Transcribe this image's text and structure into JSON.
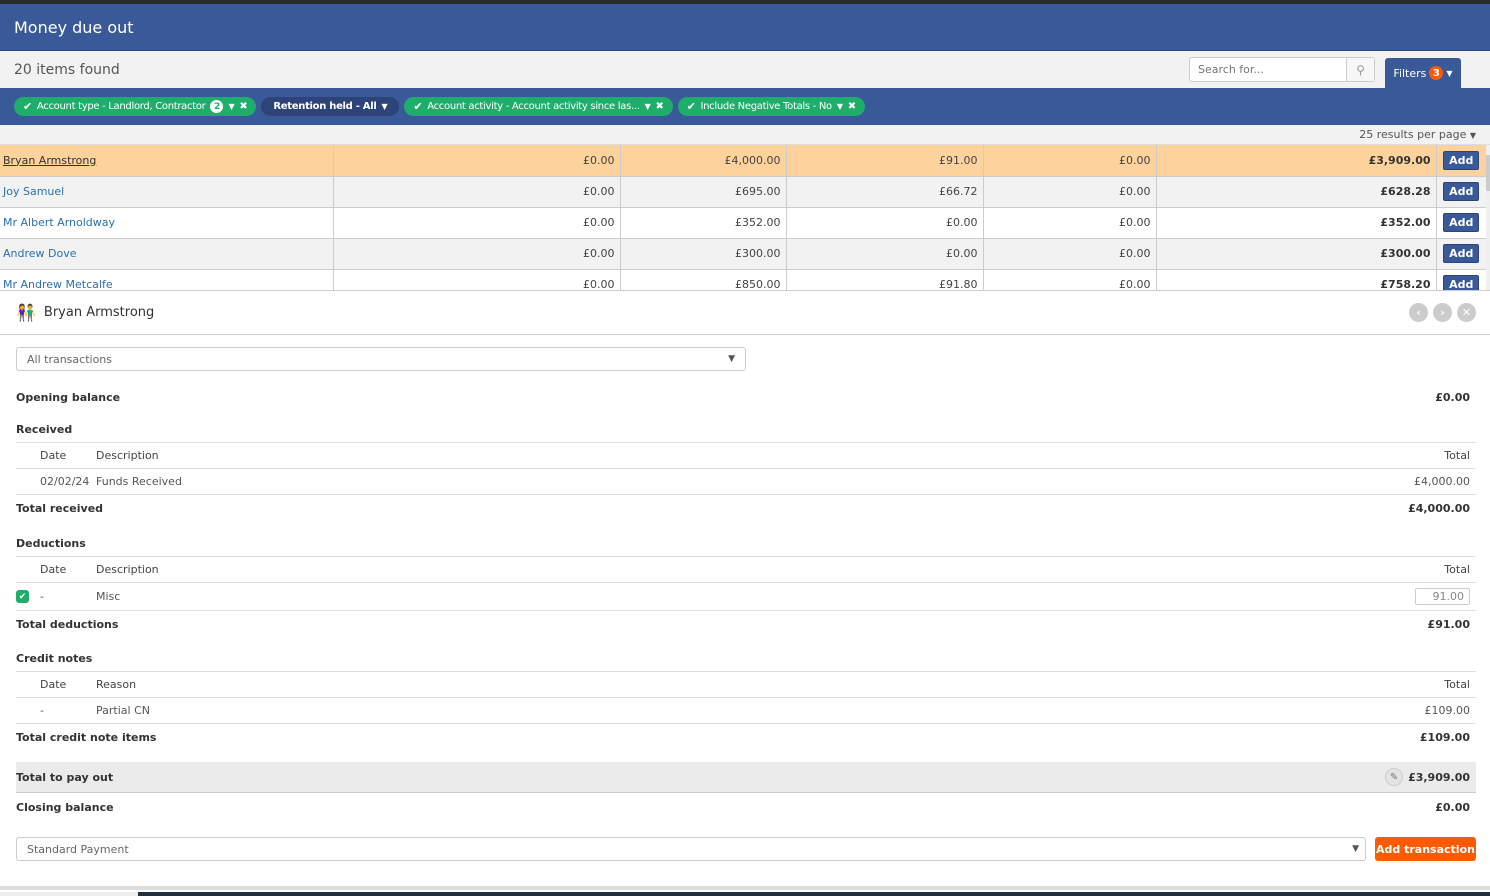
{
  "header": {
    "title": "Money due out"
  },
  "toolbar": {
    "items_found": "20 items found",
    "search_placeholder": "Search for...",
    "filters_label": "Filters",
    "filters_count": "3"
  },
  "filter_chips": [
    {
      "label": "Account type - Landlord, Contractor",
      "count": "2",
      "active": true,
      "removable": true
    },
    {
      "label": "Retention held - All",
      "active": false,
      "removable": false
    },
    {
      "label": "Account activity - Account activity since las...",
      "active": true,
      "removable": true
    },
    {
      "label": "Include Negative Totals - No",
      "active": true,
      "removable": true
    }
  ],
  "results_per_page": "25 results per page",
  "grid": {
    "add_label": "Add",
    "rows": [
      {
        "name": "Bryan Armstrong",
        "c1": "£0.00",
        "c2": "£4,000.00",
        "c3": "£91.00",
        "c4": "£0.00",
        "total": "£3,909.00",
        "selected": true
      },
      {
        "name": "Joy Samuel",
        "c1": "£0.00",
        "c2": "£695.00",
        "c3": "£66.72",
        "c4": "£0.00",
        "total": "£628.28"
      },
      {
        "name": "Mr Albert Arnoldway",
        "c1": "£0.00",
        "c2": "£352.00",
        "c3": "£0.00",
        "c4": "£0.00",
        "total": "£352.00"
      },
      {
        "name": "Andrew Dove",
        "c1": "£0.00",
        "c2": "£300.00",
        "c3": "£0.00",
        "c4": "£0.00",
        "total": "£300.00"
      },
      {
        "name": "Mr Andrew Metcalfe",
        "c1": "£0.00",
        "c2": "£850.00",
        "c3": "£91.80",
        "c4": "£0.00",
        "total": "£758.20"
      }
    ]
  },
  "detail": {
    "name": "Bryan Armstrong",
    "transaction_filter": "All transactions",
    "opening_balance_label": "Opening balance",
    "opening_balance": "£0.00",
    "received": {
      "title": "Received",
      "headers": {
        "date": "Date",
        "description": "Description",
        "total": "Total"
      },
      "rows": [
        {
          "date": "02/02/24",
          "description": "Funds Received",
          "total": "£4,000.00"
        }
      ],
      "total_label": "Total received",
      "total": "£4,000.00"
    },
    "deductions": {
      "title": "Deductions",
      "headers": {
        "date": "Date",
        "description": "Description",
        "total": "Total"
      },
      "rows": [
        {
          "checked": true,
          "date": "-",
          "description": "Misc",
          "amount": "91.00"
        }
      ],
      "total_label": "Total deductions",
      "total": "£91.00"
    },
    "credit_notes": {
      "title": "Credit notes",
      "headers": {
        "date": "Date",
        "reason": "Reason",
        "total": "Total"
      },
      "rows": [
        {
          "date": "-",
          "reason": "Partial CN",
          "total": "£109.00"
        }
      ],
      "total_label": "Total credit note items",
      "total": "£109.00"
    },
    "pay_out_label": "Total to pay out",
    "pay_out": "£3,909.00",
    "closing_balance_label": "Closing balance",
    "closing_balance": "£0.00",
    "payment_type": "Standard Payment",
    "add_transaction_label": "Add transaction"
  }
}
